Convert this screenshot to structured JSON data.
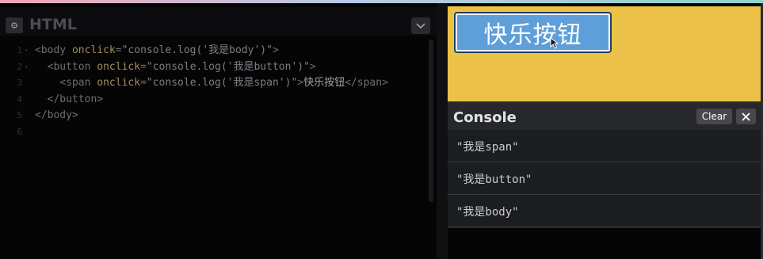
{
  "editor": {
    "title": "HTML",
    "lines": [
      {
        "n": "1",
        "indent": "",
        "parts": [
          [
            "tag",
            "<body "
          ],
          [
            "attr",
            "onclick"
          ],
          [
            "tag",
            "="
          ],
          [
            "str",
            "\"console.log('我是body')\""
          ],
          [
            "tag",
            ">"
          ]
        ]
      },
      {
        "n": "2",
        "indent": "  ",
        "parts": [
          [
            "tag",
            "<button "
          ],
          [
            "attr",
            "onclick"
          ],
          [
            "tag",
            "="
          ],
          [
            "str",
            "\"console.log('我是button')\""
          ],
          [
            "tag",
            ">"
          ]
        ]
      },
      {
        "n": "3",
        "indent": "    ",
        "parts": [
          [
            "tag",
            "<span "
          ],
          [
            "attr",
            "onclick"
          ],
          [
            "tag",
            "="
          ],
          [
            "str",
            "\"console.log('我是span')\""
          ],
          [
            "tag",
            ">"
          ],
          [
            "txt",
            "快乐按钮"
          ],
          [
            "tag",
            "</span>"
          ]
        ]
      },
      {
        "n": "4",
        "indent": "  ",
        "parts": [
          [
            "tag",
            "</button>"
          ]
        ]
      },
      {
        "n": "5",
        "indent": "",
        "parts": [
          [
            "tag",
            "</body>"
          ]
        ]
      },
      {
        "n": "6",
        "indent": "",
        "parts": []
      }
    ]
  },
  "preview": {
    "button_label": "快乐按钮"
  },
  "console": {
    "title": "Console",
    "clear_label": "Clear",
    "logs": [
      "\"我是span\"",
      "\"我是button\"",
      "\"我是body\""
    ]
  },
  "colors": {
    "preview_bg": "#ecc148",
    "button_bg": "#5e9fd9",
    "console_bg": "#1c1d20"
  },
  "icons": {
    "settings": "gear-icon",
    "collapse": "chevron-down-icon",
    "close": "close-icon",
    "cursor": "cursor-pointer-icon"
  }
}
